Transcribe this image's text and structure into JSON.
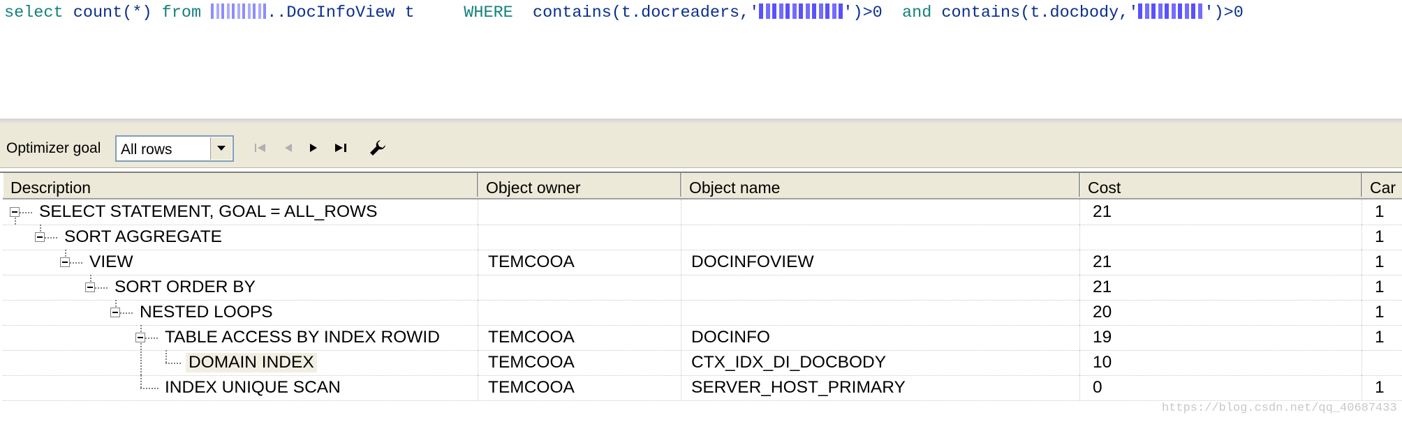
{
  "editor": {
    "sql": {
      "kw_select": "select",
      "count": "count(*)",
      "kw_from": "from",
      "table": "..DocInfoView t",
      "kw_where": "WHERE",
      "cond1_start": "contains(t.docreaders,'",
      "cond1_end": "')>0",
      "kw_and": "and",
      "cond2_start": "contains(t.docbody,'",
      "cond2_end": "')>0"
    }
  },
  "toolbar": {
    "optimizer_label": "Optimizer goal",
    "optimizer_value": "All rows",
    "buttons": [
      "first-icon",
      "prev-icon",
      "next-icon",
      "last-icon",
      "wrench-icon"
    ]
  },
  "grid": {
    "columns": [
      "Description",
      "Object owner",
      "Object name",
      "Cost",
      "Car"
    ],
    "rows": [
      {
        "description": "SELECT STATEMENT, GOAL = ALL_ROWS",
        "owner": "",
        "name": "",
        "cost": "21",
        "card": "1"
      },
      {
        "description": "SORT AGGREGATE",
        "owner": "",
        "name": "",
        "cost": "",
        "card": "1"
      },
      {
        "description": "VIEW",
        "owner": "TEMCOOA",
        "name": "DOCINFOVIEW",
        "cost": "21",
        "card": "1"
      },
      {
        "description": "SORT ORDER BY",
        "owner": "",
        "name": "",
        "cost": "21",
        "card": "1"
      },
      {
        "description": "NESTED LOOPS",
        "owner": "",
        "name": "",
        "cost": "20",
        "card": "1"
      },
      {
        "description": "TABLE ACCESS BY INDEX ROWID",
        "owner": "TEMCOOA",
        "name": "DOCINFO",
        "cost": "19",
        "card": "1"
      },
      {
        "description": "DOMAIN INDEX",
        "owner": "TEMCOOA",
        "name": "CTX_IDX_DI_DOCBODY",
        "cost": "10",
        "card": ""
      },
      {
        "description": "INDEX UNIQUE SCAN",
        "owner": "TEMCOOA",
        "name": "SERVER_HOST_PRIMARY",
        "cost": "0",
        "card": "1"
      }
    ]
  },
  "watermark": "https://blog.csdn.net/qq_40687433"
}
